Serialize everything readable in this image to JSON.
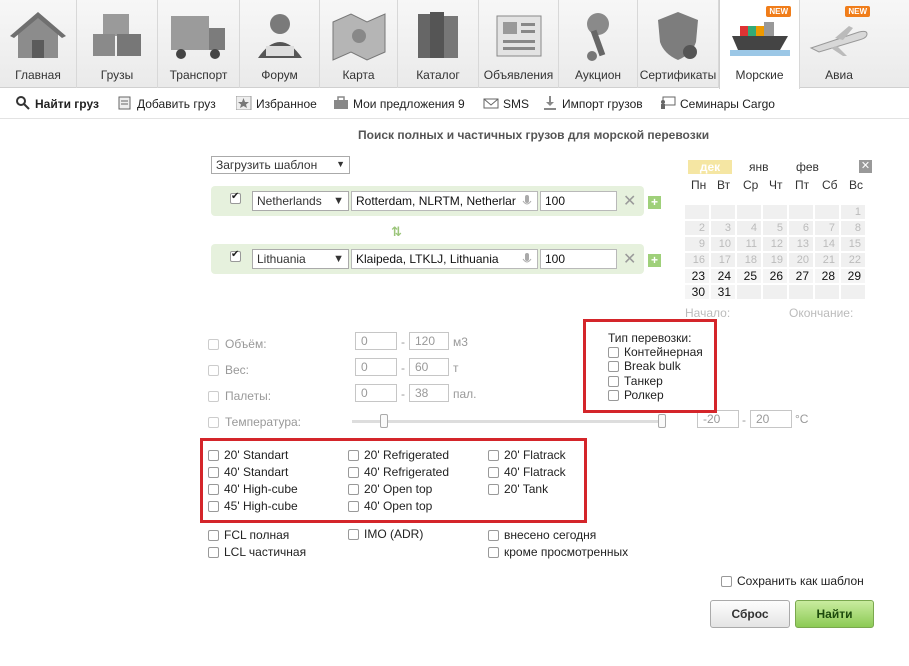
{
  "nav": {
    "tabs": [
      {
        "label": "Главная",
        "icon": "house-icon"
      },
      {
        "label": "Грузы",
        "icon": "boxes-icon"
      },
      {
        "label": "Транспорт",
        "icon": "truck-icon"
      },
      {
        "label": "Форум",
        "icon": "person-icon"
      },
      {
        "label": "Карта",
        "icon": "map-icon"
      },
      {
        "label": "Каталог",
        "icon": "books-icon"
      },
      {
        "label": "Объявления",
        "icon": "newspaper-icon"
      },
      {
        "label": "Аукцион",
        "icon": "piston-icon"
      },
      {
        "label": "Сертификаты",
        "icon": "shield-icon"
      },
      {
        "label": "Морские",
        "icon": "ship-icon",
        "badge": "NEW"
      },
      {
        "label": "Авиа",
        "icon": "plane-icon",
        "badge": "NEW"
      }
    ]
  },
  "subnav": {
    "find": "Найти груз",
    "add": "Добавить груз",
    "favorites": "Избранное",
    "offers": "Мои предложения 9",
    "sms": "SMS",
    "import": "Импорт грузов",
    "seminars": "Семинары Cargo"
  },
  "title": "Поиск полных и частичных грузов для морской перевозки",
  "template_select": "Загрузить шаблон",
  "from": {
    "country": "Netherlands",
    "place": "Rotterdam, NLRTM, Netherlar",
    "radius": "100"
  },
  "to": {
    "country": "Lithuania",
    "place": "Klaipeda, LTKLJ, Lithuania",
    "radius": "100"
  },
  "swap_icon": "swap-arrows-icon",
  "calendar": {
    "months": [
      "дек",
      "янв",
      "фев"
    ],
    "dow": [
      "Пн",
      "Вт",
      "Ср",
      "Чт",
      "Пт",
      "Сб",
      "Вс"
    ],
    "rows": [
      [
        "",
        "",
        "",
        "",
        "",
        "",
        "1"
      ],
      [
        "2",
        "3",
        "4",
        "5",
        "6",
        "7",
        "8"
      ],
      [
        "9",
        "10",
        "11",
        "12",
        "13",
        "14",
        "15"
      ],
      [
        "16",
        "17",
        "18",
        "19",
        "20",
        "21",
        "22"
      ],
      [
        "23",
        "24",
        "25",
        "26",
        "27",
        "28",
        "29"
      ],
      [
        "30",
        "31",
        "",
        "",
        "",
        "",
        ""
      ]
    ],
    "start_label": "Начало:",
    "end_label": "Окончание:",
    "accent": "#f5e6a3"
  },
  "ranges": {
    "volume": {
      "label": "Объём:",
      "min": "0",
      "max": "120",
      "unit": "м3"
    },
    "weight": {
      "label": "Вес:",
      "min": "0",
      "max": "60",
      "unit": "т"
    },
    "pallets": {
      "label": "Палеты:",
      "min": "0",
      "max": "38",
      "unit": "пал."
    },
    "temperature": {
      "label": "Температура:",
      "min": "-20",
      "max": "20",
      "unit": "°C"
    }
  },
  "transport_type": {
    "title": "Тип перевозки:",
    "options": [
      "Контейнерная",
      "Break bulk",
      "Танкер",
      "Ролкер"
    ]
  },
  "containers": {
    "col1": [
      "20' Standart",
      "40' Standart",
      "40' High-cube",
      "45' High-cube"
    ],
    "col2": [
      "20' Refrigerated",
      "40' Refrigerated",
      "20' Open top",
      "40' Open top"
    ],
    "col3": [
      "20' Flatrack",
      "40' Flatrack",
      "20' Tank"
    ]
  },
  "extra": {
    "fcl": "FCL полная",
    "lcl": "LCL частичная",
    "imo": "IMO (ADR)",
    "today": "внесено сегодня",
    "unseen": "кроме просмотренных"
  },
  "save_template": "Сохранить как шаблон",
  "buttons": {
    "reset": "Сброс",
    "find": "Найти"
  },
  "colors": {
    "highlight": "#d4252a",
    "route_bg": "#e6f1dd",
    "find_btn": "#8cca55"
  }
}
